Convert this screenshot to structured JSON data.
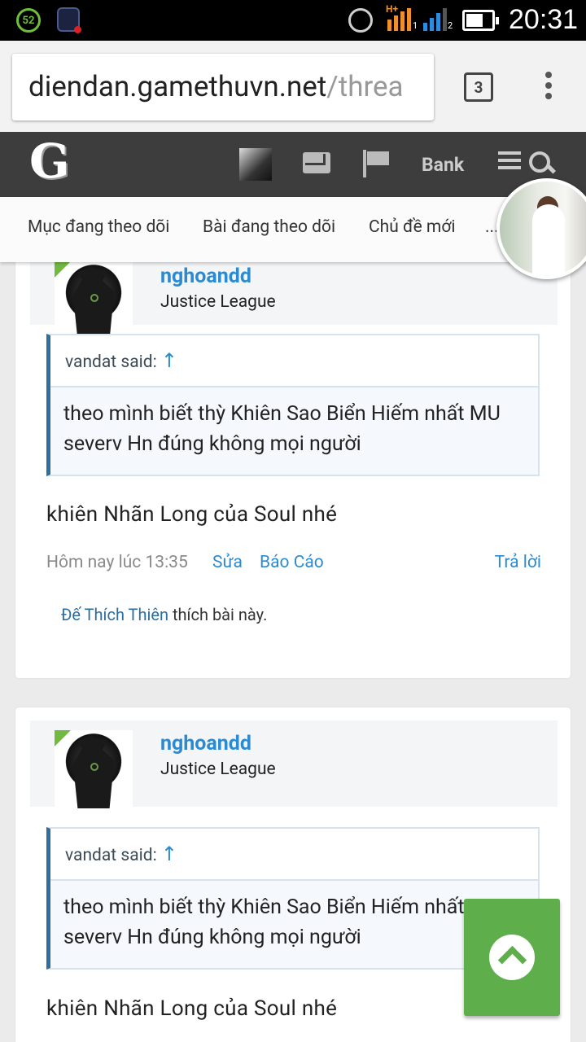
{
  "statusbar": {
    "badge": "52",
    "time": "20:31",
    "signal1_label": "1",
    "signal2_label": "2",
    "network": "H+"
  },
  "browser": {
    "url_host": "diendan.gamethuvn.net",
    "url_rest": "/threa",
    "tab_count": "3"
  },
  "site": {
    "logo": "G",
    "bank_label": "Bank"
  },
  "subnav": {
    "items": [
      {
        "label": "Mục đang theo dõi"
      },
      {
        "label": "Bài đang theo dõi"
      },
      {
        "label": "Chủ đề mới"
      },
      {
        "label": "..."
      }
    ]
  },
  "posts": [
    {
      "username": "nghoandd",
      "user_title": "Justice League",
      "quote_author": "vandat said:",
      "quote_arrow": "↑",
      "quote_text": "theo mình biết thỳ Khiên Sao Biển Hiếm nhất MU severv Hn đúng không mọi người",
      "message": "khiên Nhãn Long của Soul nhé",
      "timestamp": "Hôm nay lúc 13:35",
      "edit_label": "Sửa",
      "report_label": "Báo Cáo",
      "reply_label": "Trả lời",
      "liker": "Đế Thích Thiên",
      "likes_suffix": "thích bài này."
    },
    {
      "username": "nghoandd",
      "user_title": "Justice League",
      "quote_author": "vandat said:",
      "quote_arrow": "↑",
      "quote_text": "theo mình biết thỳ Khiên Sao Biển Hiếm nhất MU severv Hn đúng không mọi người",
      "message": "khiên Nhãn Long của Soul nhé"
    }
  ]
}
